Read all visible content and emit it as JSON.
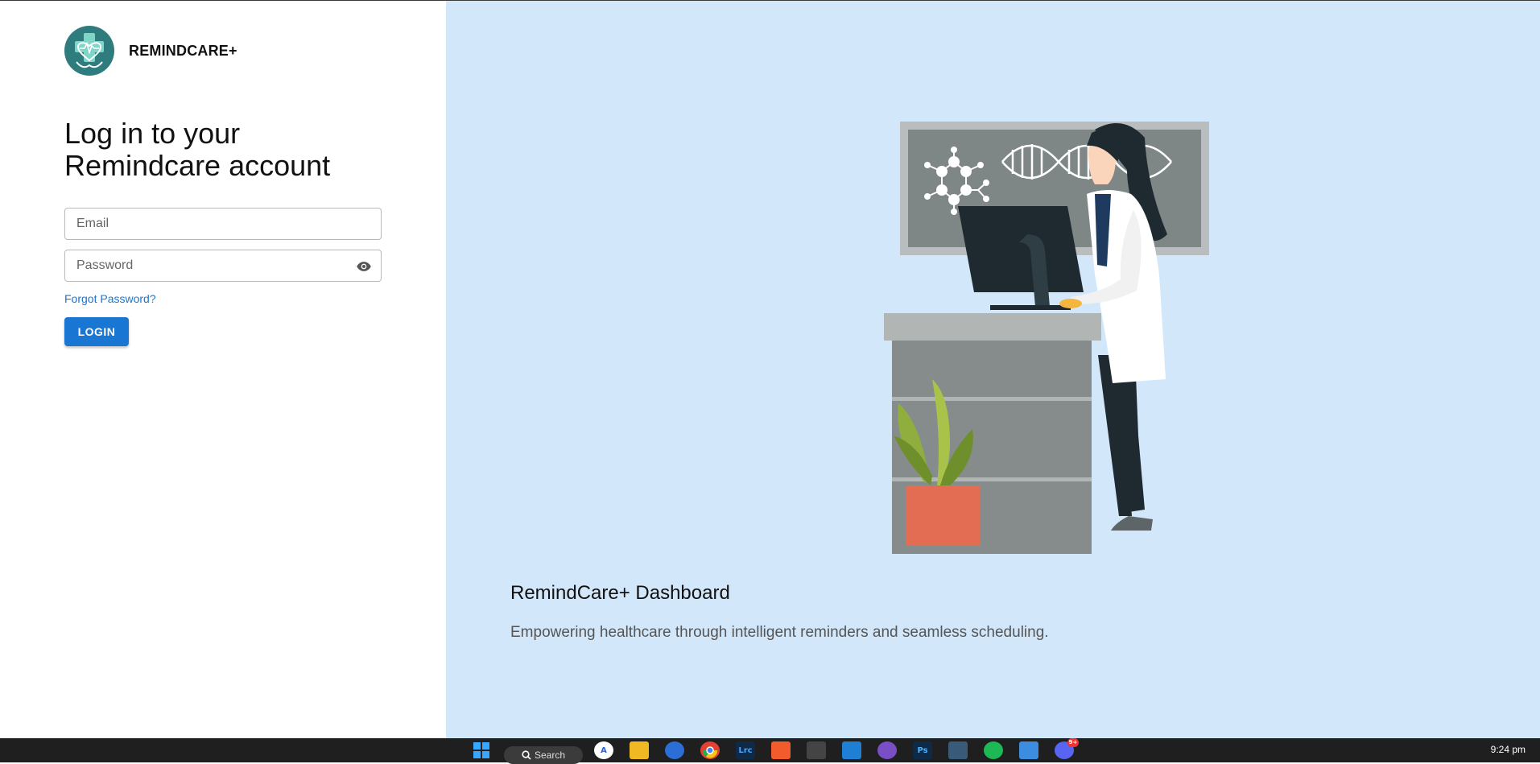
{
  "brand": {
    "name": "REMINDCARE+",
    "logo_icon": "medical-heart-cross-icon"
  },
  "login": {
    "heading": "Log in to your Remindcare account",
    "email_placeholder": "Email",
    "password_placeholder": "Password",
    "forgot_label": "Forgot Password?",
    "login_label": "LOGIN"
  },
  "hero": {
    "title": "RemindCare+ Dashboard",
    "subtitle": "Empowering healthcare through intelligent reminders and seamless scheduling."
  },
  "taskbar": {
    "search_label": "Search",
    "time": "9:24 pm",
    "notification_count": "9+",
    "items": [
      "windows-start-icon",
      "search-icon",
      "app-icon",
      "file-explorer-icon",
      "firefox-icon",
      "chrome-icon",
      "lightroom-icon",
      "brave-icon",
      "app-icon",
      "vscode-icon",
      "github-icon",
      "photoshop-icon",
      "app-icon",
      "spotify-icon",
      "notepad-icon",
      "discord-icon"
    ]
  },
  "colors": {
    "accent": "#1976d2",
    "hero_background": "#d3e7fa",
    "logo_teal": "#2f7c7e",
    "taskbar": "#1f1f1f"
  }
}
